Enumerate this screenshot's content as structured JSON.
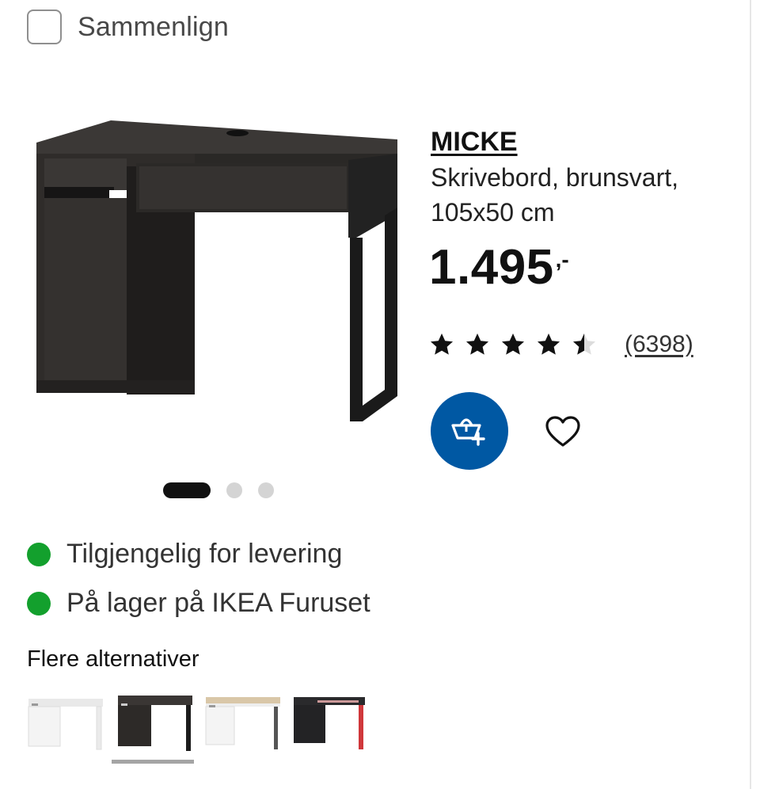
{
  "compare": {
    "label": "Sammenlign"
  },
  "product": {
    "name": "MICKE",
    "description": "Skrivebord, brunsvart, 105x50 cm",
    "price": "1.495",
    "price_suffix": ",-",
    "rating_value": 4.5,
    "rating_max": 5,
    "review_count": "(6398)"
  },
  "carousel": {
    "total": 3,
    "active_index": 0
  },
  "availability": [
    {
      "text": "Tilgjengelig for levering",
      "status_color": "#13a02d"
    },
    {
      "text": "På lager på IKEA Furuset",
      "status_color": "#13a02d"
    }
  ],
  "alternatives": {
    "title": "Flere alternativer",
    "items": [
      {
        "variant": "white",
        "selected": false
      },
      {
        "variant": "black-brown",
        "selected": true
      },
      {
        "variant": "white-oak",
        "selected": false
      },
      {
        "variant": "black-red",
        "selected": false
      }
    ]
  },
  "colors": {
    "accent": "#0058a3",
    "available": "#13a02d",
    "text": "#111111"
  },
  "icons": {
    "cart": "add-to-basket-icon",
    "favourite": "heart-icon",
    "star": "star-icon"
  }
}
